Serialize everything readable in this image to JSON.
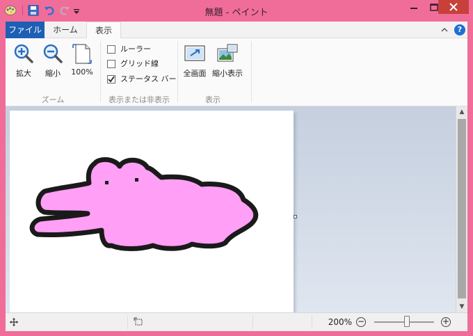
{
  "window": {
    "title": "無題 - ペイント"
  },
  "quick_access": {
    "icons": [
      "paint-app-icon",
      "save-icon",
      "undo-icon",
      "redo-icon",
      "customize-dropdown-icon"
    ]
  },
  "ribbon_tabs": [
    {
      "label": "ファイル",
      "active": false
    },
    {
      "label": "ホーム",
      "active": false
    },
    {
      "label": "表示",
      "active": true
    }
  ],
  "groups": {
    "zoom": {
      "label": "ズーム",
      "buttons": [
        {
          "label": "拡大",
          "icon": "zoom-in-icon"
        },
        {
          "label": "縮小",
          "icon": "zoom-out-icon"
        },
        {
          "label": "100%",
          "icon": "page-100-icon"
        }
      ]
    },
    "show_hide": {
      "label": "表示または非表示",
      "options": [
        {
          "label": "ルーラー",
          "checked": false
        },
        {
          "label": "グリッド線",
          "checked": false
        },
        {
          "label": "ステータス バー",
          "checked": true
        }
      ]
    },
    "display": {
      "label": "表示",
      "buttons": [
        {
          "label": "全画面",
          "icon": "fullscreen-icon"
        },
        {
          "label": "縮小表示",
          "icon": "thumbnail-icon"
        }
      ]
    }
  },
  "status": {
    "zoom_label": "200%",
    "zoom_level_fraction": 0.55
  },
  "colors": {
    "frame": "#f06d9a",
    "accent": "#1e5fb5",
    "blob_fill": "#ff9ff6",
    "blob_outline": "#1a1a1a"
  }
}
